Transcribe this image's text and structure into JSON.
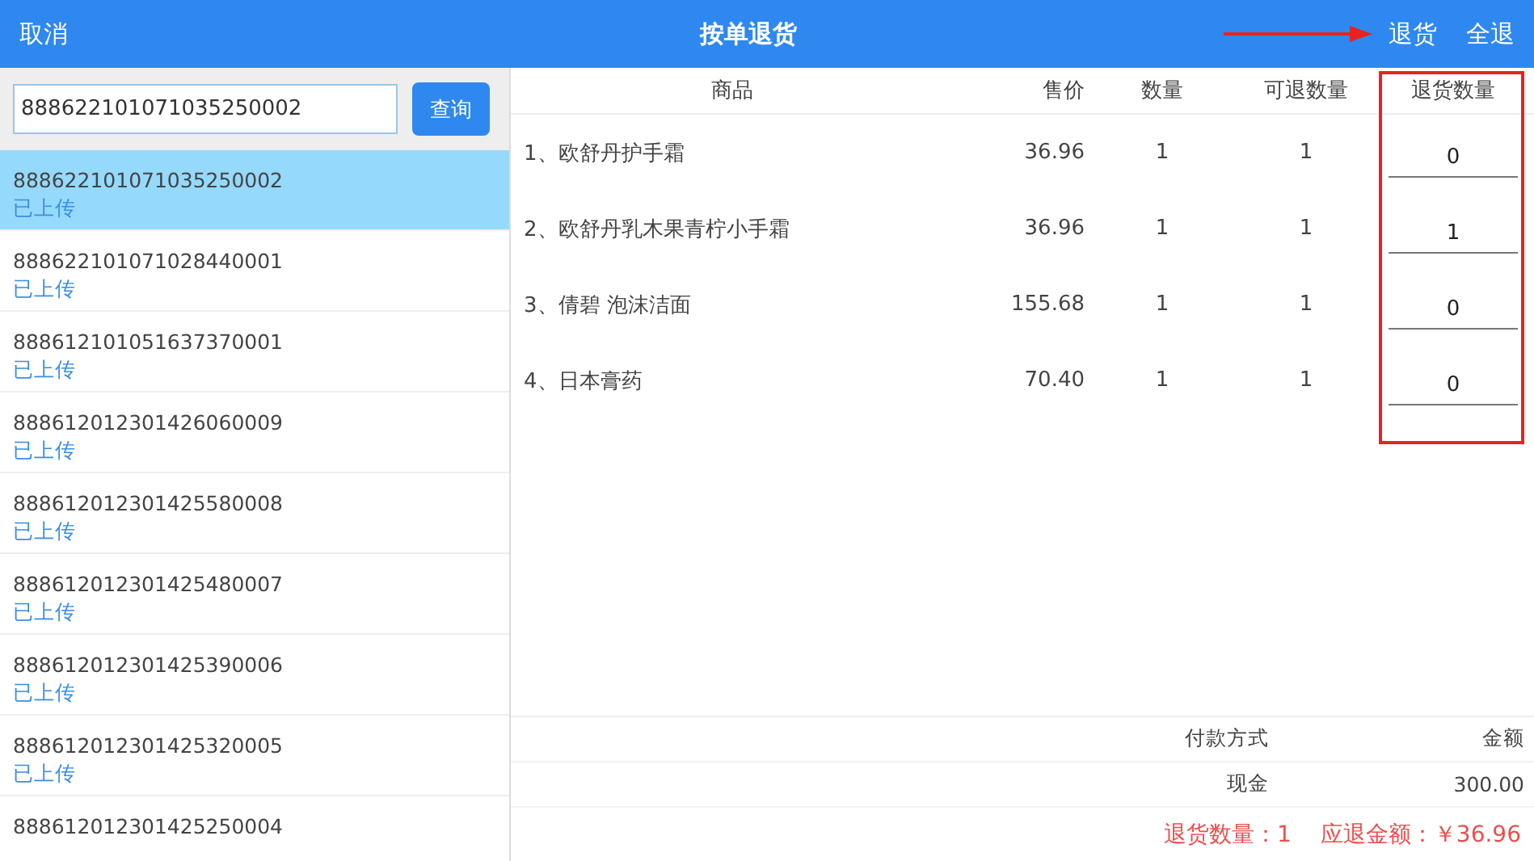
{
  "header": {
    "cancel": "取消",
    "title": "按单退货",
    "actions": [
      "退货",
      "全退"
    ]
  },
  "search": {
    "value": "888622101071035250002",
    "button": "查询"
  },
  "orders": [
    {
      "number": "888622101071035250002",
      "status": "已上传",
      "selected": true
    },
    {
      "number": "888622101071028440001",
      "status": "已上传",
      "selected": false
    },
    {
      "number": "888612101051637370001",
      "status": "已上传",
      "selected": false
    },
    {
      "number": "888612012301426060009",
      "status": "已上传",
      "selected": false
    },
    {
      "number": "888612012301425580008",
      "status": "已上传",
      "selected": false
    },
    {
      "number": "888612012301425480007",
      "status": "已上传",
      "selected": false
    },
    {
      "number": "888612012301425390006",
      "status": "已上传",
      "selected": false
    },
    {
      "number": "888612012301425320005",
      "status": "已上传",
      "selected": false
    },
    {
      "number": "888612012301425250004",
      "selected": false
    }
  ],
  "table": {
    "columns": [
      "商品",
      "售价",
      "数量",
      "可退数量",
      "退货数量"
    ],
    "rows": [
      {
        "product": "1、欧舒丹护手霜",
        "price": "36.96",
        "qty": "1",
        "returnable": "1",
        "return_qty": "0"
      },
      {
        "product": "2、欧舒丹乳木果青柠小手霜",
        "price": "36.96",
        "qty": "1",
        "returnable": "1",
        "return_qty": "1"
      },
      {
        "product": "3、倩碧  泡沫洁面",
        "price": "155.68",
        "qty": "1",
        "returnable": "1",
        "return_qty": "0"
      },
      {
        "product": "4、日本膏药",
        "price": "70.40",
        "qty": "1",
        "returnable": "1",
        "return_qty": "0"
      }
    ]
  },
  "payment": {
    "columns": [
      "付款方式",
      "金额"
    ],
    "rows": [
      {
        "method": "现金",
        "amount": "300.00"
      }
    ]
  },
  "summary": {
    "return_qty": "退货数量：1",
    "refund": "应退金额：￥36.96"
  }
}
